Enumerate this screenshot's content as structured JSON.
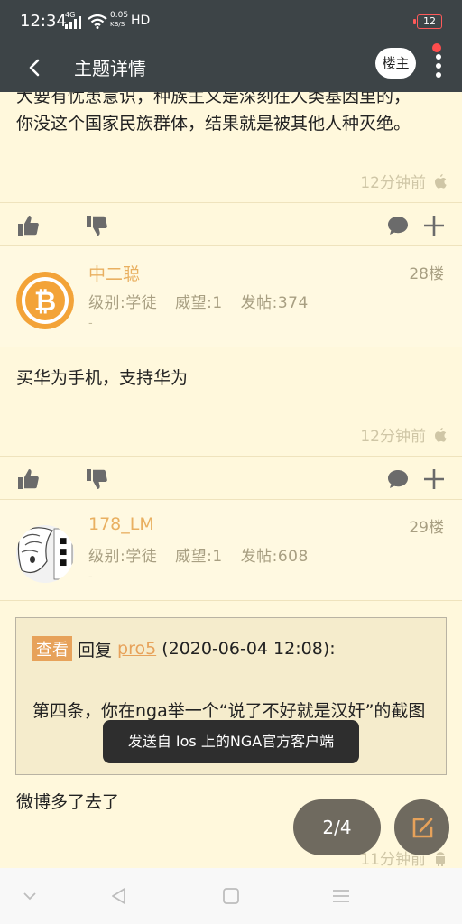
{
  "status_bar": {
    "time": "12:34",
    "network": "4G",
    "speed_value": "0.05",
    "speed_unit": "KB/S",
    "hd": "HD",
    "battery": "12"
  },
  "app_bar": {
    "title": "主题详情",
    "louzhu_label": "楼主"
  },
  "posts": [
    {
      "text_lines": [
        "大要有忧患意识，种族主义是深刻在人类基因里的，",
        "你没这个国家民族群体，结果就是被其他人种灭绝。"
      ],
      "time": "12分钟前",
      "platform_icon": "apple-icon"
    },
    {
      "author": "中二聪",
      "floor": "28楼",
      "level": "级别:学徒",
      "prestige": "威望:1",
      "post_count": "发帖:374",
      "signature": "-",
      "avatar_icon": "bitcoin-icon",
      "text": "买华为手机，支持华为",
      "time": "12分钟前",
      "platform_icon": "apple-icon"
    },
    {
      "author": "178_LM",
      "floor": "29楼",
      "level": "级别:学徒",
      "prestige": "威望:1",
      "post_count": "发帖:608",
      "signature": "-",
      "avatar_icon": "anime-avatar",
      "quote": {
        "view_label": "查看",
        "reply_prefix": "回复",
        "quoted_user": "pro5",
        "quoted_time": "(2020-06-04 12:08):",
        "body": "第四条，你在nga举一个“说了不好就是汉奸”的截图"
      },
      "text": "微博多了去了",
      "time": "11分钟前",
      "platform_icon": "android-icon"
    }
  ],
  "toast": "发送自 Ios 上的NGA官方客户端",
  "page_indicator": "2/4",
  "colors": {
    "bar_bg": "#3d4447",
    "page_bg": "#fff8dc",
    "accent": "#e9b061",
    "fab_bg": "#6f6a5f"
  }
}
